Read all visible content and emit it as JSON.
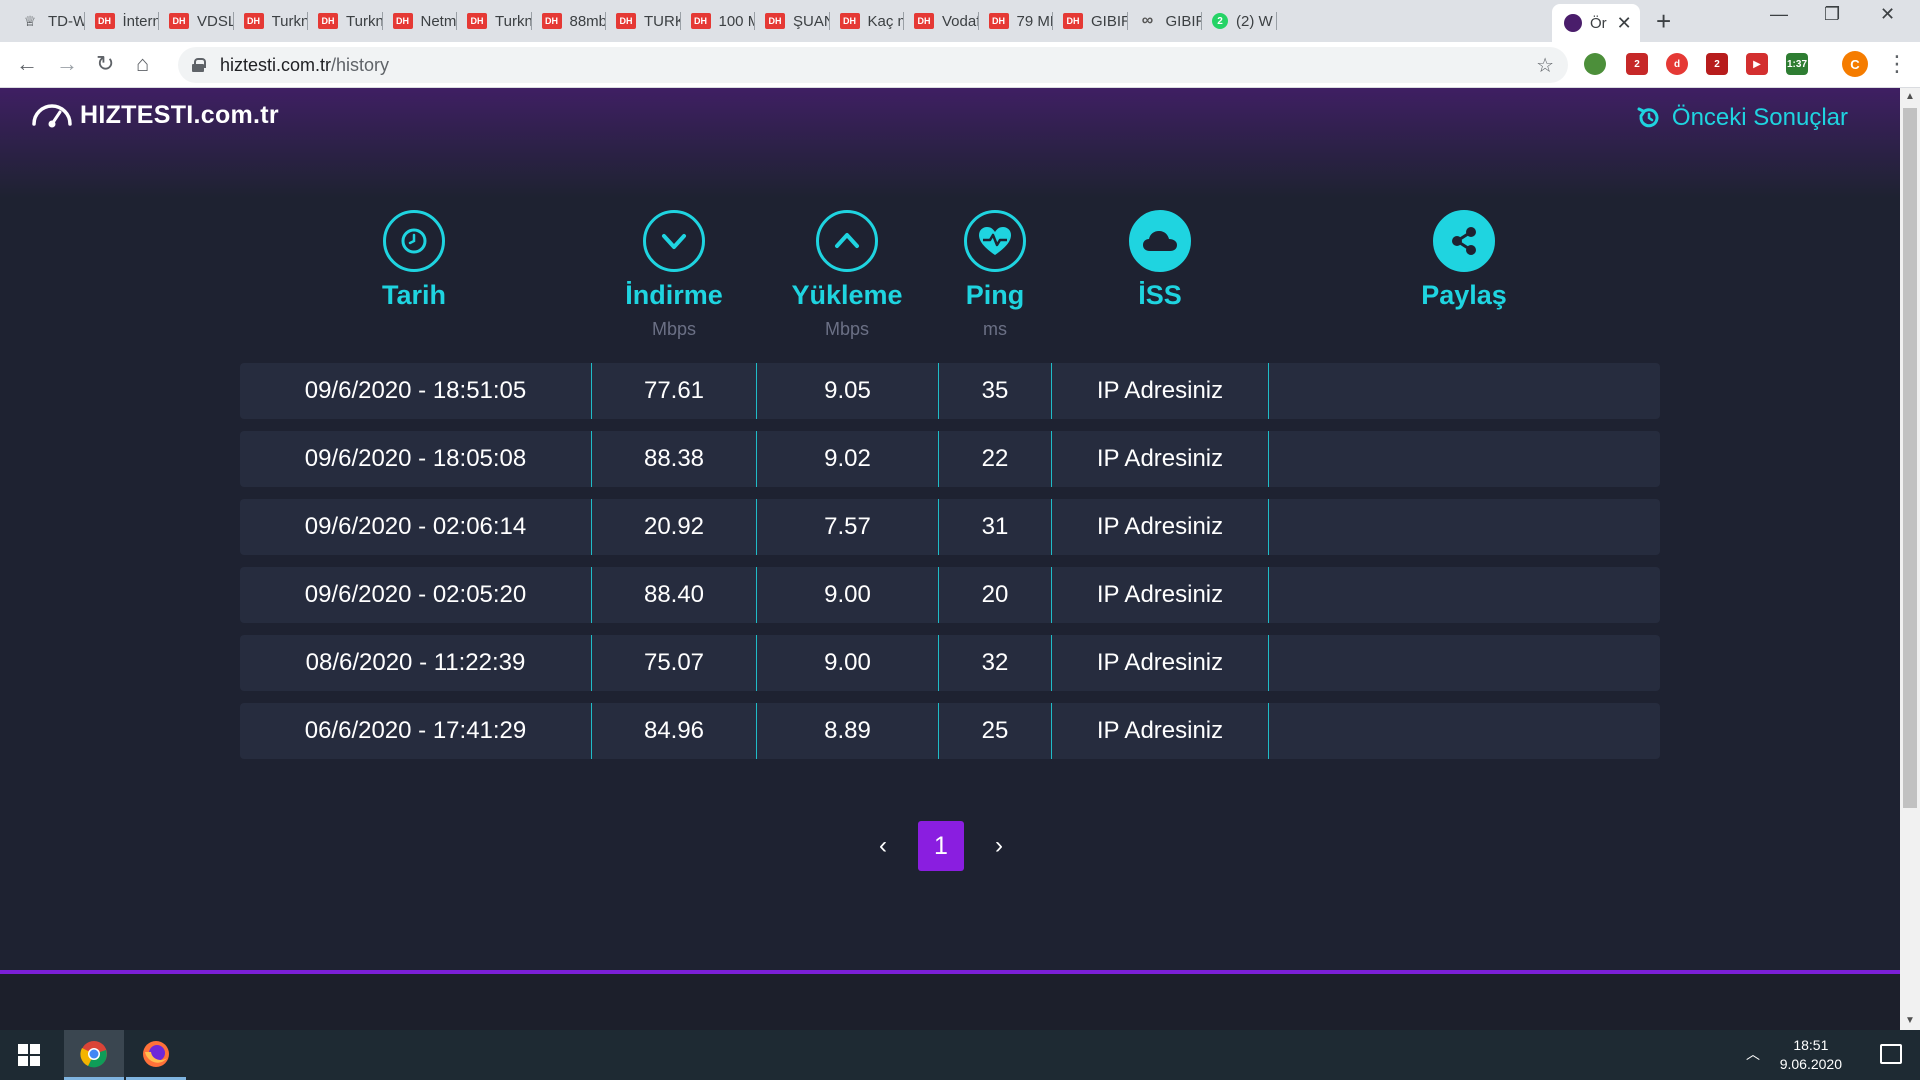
{
  "browser": {
    "tabs": [
      {
        "icon": "td-icon",
        "title": "TD-W"
      },
      {
        "icon": "dh-icon",
        "title": "İntern"
      },
      {
        "icon": "dh-icon",
        "title": "VDSL"
      },
      {
        "icon": "dh-icon",
        "title": "Turkn"
      },
      {
        "icon": "dh-icon",
        "title": "Turkn"
      },
      {
        "icon": "dh-icon",
        "title": "Netm"
      },
      {
        "icon": "dh-icon",
        "title": "Turkn"
      },
      {
        "icon": "dh-icon",
        "title": "88mb"
      },
      {
        "icon": "dh-icon",
        "title": "TURK"
      },
      {
        "icon": "dh-icon",
        "title": "100 M"
      },
      {
        "icon": "dh-icon",
        "title": "ŞUAN"
      },
      {
        "icon": "dh-icon",
        "title": "Kaç m"
      },
      {
        "icon": "dh-icon",
        "title": "Vodaf"
      },
      {
        "icon": "dh-icon",
        "title": "79 ME"
      },
      {
        "icon": "dh-icon",
        "title": "GIBIR"
      },
      {
        "icon": "infinity-icon",
        "title": "GIBIR"
      },
      {
        "icon": "whatsapp-icon",
        "title": "(2) W"
      }
    ],
    "dh_label": "DH",
    "wa_badge": "2",
    "active_tab": {
      "title": "Ör"
    },
    "url_host": "hiztesti.com.tr",
    "url_path": "/history",
    "ext_badges": [
      "2",
      "2",
      "1:37"
    ],
    "profile_initial": "C"
  },
  "page": {
    "logo_text": "HIZTESTI.com.tr",
    "prev_results_label": "Önceki Sonuçlar",
    "columns": [
      {
        "key": "tarih",
        "label": "Tarih",
        "unit": "",
        "icon": "clock-icon"
      },
      {
        "key": "indirme",
        "label": "İndirme",
        "unit": "Mbps",
        "icon": "chevron-down-icon"
      },
      {
        "key": "yukleme",
        "label": "Yükleme",
        "unit": "Mbps",
        "icon": "chevron-up-icon"
      },
      {
        "key": "ping",
        "label": "Ping",
        "unit": "ms",
        "icon": "heartbeat-icon"
      },
      {
        "key": "iss",
        "label": "İSS",
        "unit": "",
        "icon": "cloud-icon"
      },
      {
        "key": "paylas",
        "label": "Paylaş",
        "unit": "",
        "icon": "share-icon"
      }
    ],
    "rows": [
      {
        "date": "09/6/2020 - 18:51:05",
        "download": "77.61",
        "upload": "9.05",
        "ping": "35",
        "isp": "IP Adresiniz"
      },
      {
        "date": "09/6/2020 - 18:05:08",
        "download": "88.38",
        "upload": "9.02",
        "ping": "22",
        "isp": "IP Adresiniz"
      },
      {
        "date": "09/6/2020 - 02:06:14",
        "download": "20.92",
        "upload": "7.57",
        "ping": "31",
        "isp": "IP Adresiniz"
      },
      {
        "date": "09/6/2020 - 02:05:20",
        "download": "88.40",
        "upload": "9.00",
        "ping": "20",
        "isp": "IP Adresiniz"
      },
      {
        "date": "08/6/2020 - 11:22:39",
        "download": "75.07",
        "upload": "9.00",
        "ping": "32",
        "isp": "IP Adresiniz"
      },
      {
        "date": "06/6/2020 - 17:41:29",
        "download": "84.96",
        "upload": "8.89",
        "ping": "25",
        "isp": "IP Adresiniz"
      }
    ],
    "pagination": {
      "prev": "‹",
      "current": "1",
      "next": "›"
    }
  },
  "taskbar": {
    "time": "18:51",
    "date": "9.06.2020"
  },
  "colors": {
    "accent": "#1fd4e0",
    "page_bg": "#1e2231",
    "row_bg": "#262c3e",
    "pagination_active": "#8a1ee0",
    "header_purple": "#3f1f63"
  }
}
